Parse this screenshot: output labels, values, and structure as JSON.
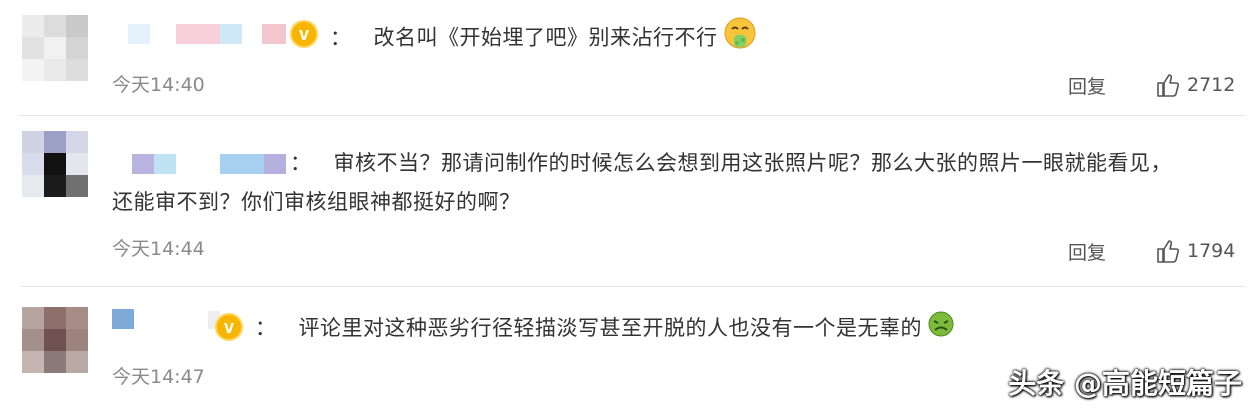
{
  "comments": [
    {
      "text": "改名叫《开始埋了吧》别来沾行不行",
      "emoji": "vomit-emoji",
      "verified": true,
      "time": "今天14:40",
      "reply": "回复",
      "likes": "2712"
    },
    {
      "text_line1": "审核不当？那请问制作的时候怎么会想到用这张照片呢？那么大张的照片一眼就能看见，",
      "text_line2": "还能审不到？你们审核组眼神都挺好的啊？",
      "verified": false,
      "time": "今天14:44",
      "reply": "回复",
      "likes": "1794"
    },
    {
      "text": "评论里对这种恶劣行径轻描淡写甚至开脱的人也没有一个是无辜的",
      "emoji": "nauseated-emoji",
      "verified": true,
      "time": "今天14:47"
    }
  ],
  "colon": "：",
  "watermark": "头条 @高能短篇子",
  "colors": {
    "verified_badge": "#f7b500",
    "time_text": "#8a8a8a",
    "divider": "#e6e6e6"
  }
}
